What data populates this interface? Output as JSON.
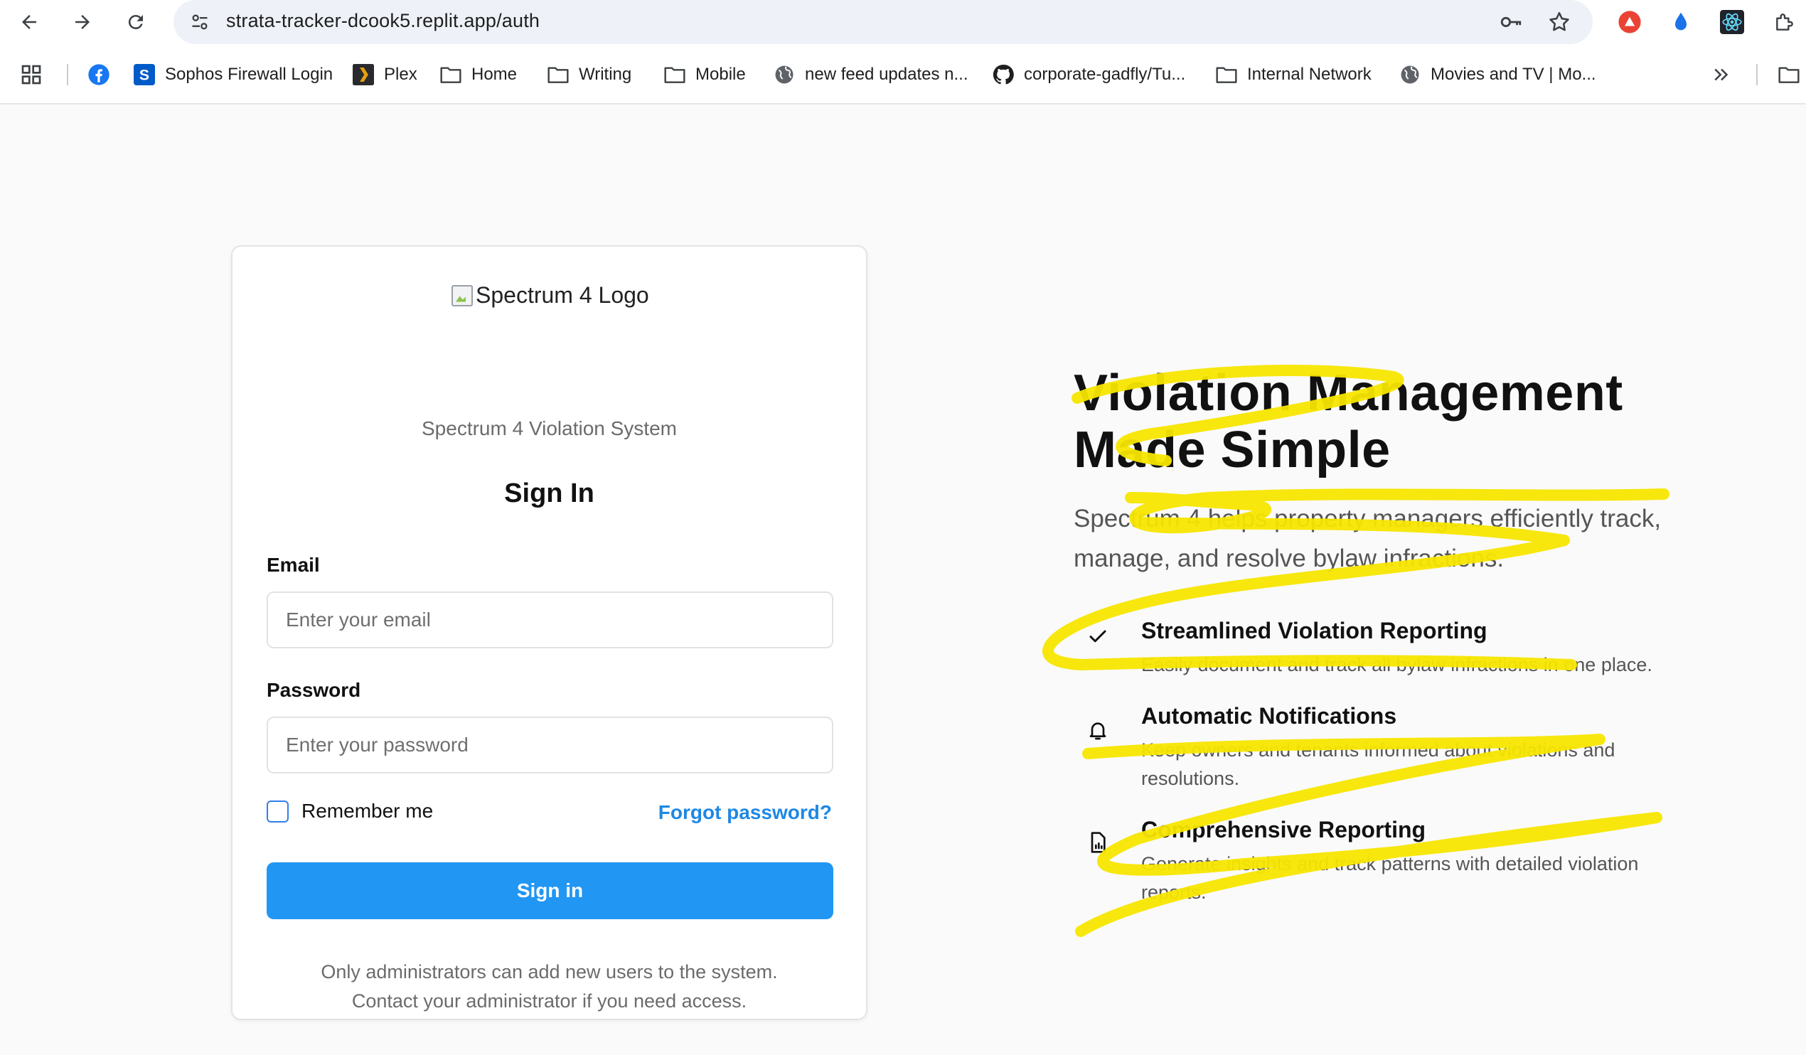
{
  "browser": {
    "url": "strata-tracker-dcook5.replit.app/auth",
    "bookmarks": [
      {
        "label": "Sophos Firewall Login",
        "icon": "sophos-icon"
      },
      {
        "label": "Plex",
        "icon": "plex-icon"
      },
      {
        "label": "Home",
        "icon": "folder-icon"
      },
      {
        "label": "Writing",
        "icon": "folder-icon"
      },
      {
        "label": "Mobile",
        "icon": "folder-icon"
      },
      {
        "label": "new feed updates n...",
        "icon": "globe-icon"
      },
      {
        "label": "corporate-gadfly/Tu...",
        "icon": "github-icon"
      },
      {
        "label": "Internal Network",
        "icon": "folder-icon"
      },
      {
        "label": "Movies and TV | Mo...",
        "icon": "globe-icon"
      }
    ]
  },
  "login": {
    "logo_alt": "Spectrum 4 Logo",
    "system_name": "Spectrum 4 Violation System",
    "title": "Sign In",
    "email_label": "Email",
    "email_placeholder": "Enter your email",
    "password_label": "Password",
    "password_placeholder": "Enter your password",
    "remember_label": "Remember me",
    "forgot_label": "Forgot password?",
    "submit_label": "Sign in",
    "note_line1": "Only administrators can add new users to the system.",
    "note_line2": "Contact your administrator if you need access."
  },
  "hero": {
    "title_line1": "Violation Management",
    "title_line2": "Made Simple",
    "description": "Spectrum 4 helps property managers efficiently track, manage, and resolve bylaw infractions.",
    "features": [
      {
        "icon": "check-icon",
        "title": "Streamlined Violation Reporting",
        "description": "Easily document and track all bylaw infractions in one place."
      },
      {
        "icon": "bell-icon",
        "title": "Automatic Notifications",
        "description": "Keep owners and tenants informed about violations and resolutions."
      },
      {
        "icon": "report-icon",
        "title": "Comprehensive Reporting",
        "description": "Generate insights and track patterns with detailed violation reports."
      }
    ]
  },
  "colors": {
    "primary": "#2196f3",
    "link": "#1e88e5",
    "highlighter": "#f7e600"
  }
}
